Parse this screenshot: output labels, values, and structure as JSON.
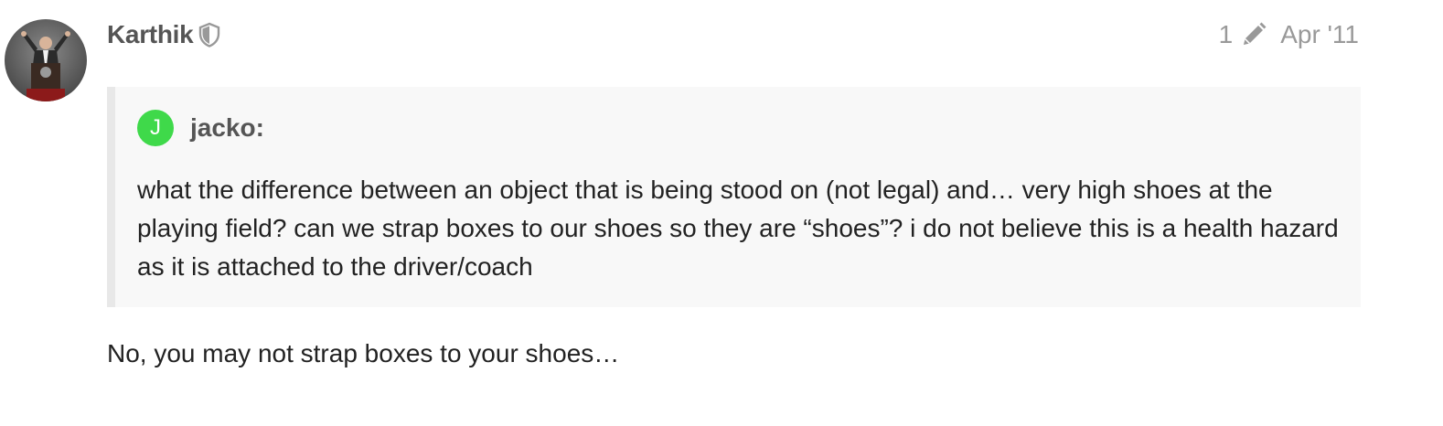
{
  "post": {
    "author": "Karthik",
    "author_badge_icon": "shield-icon",
    "avatar_icon": "user-avatar-photo",
    "edit_count": "1",
    "edit_icon": "pencil-icon",
    "date": "Apr '11",
    "quote": {
      "avatar_letter": "J",
      "avatar_color": "#3fd94a",
      "username": "jacko:",
      "text": "what the difference between an object that is being stood on (not legal) and… very high shoes at the playing field? can we strap boxes to our shoes so they are “shoes”? i do not believe this is a health hazard as it is attached to the driver/coach"
    },
    "body": "No, you may not strap boxes to your shoes…"
  },
  "colors": {
    "username": "#555555",
    "meta": "#999999",
    "quote_bg": "#f8f8f8",
    "quote_border": "#e8e8e8",
    "text": "#222222"
  }
}
